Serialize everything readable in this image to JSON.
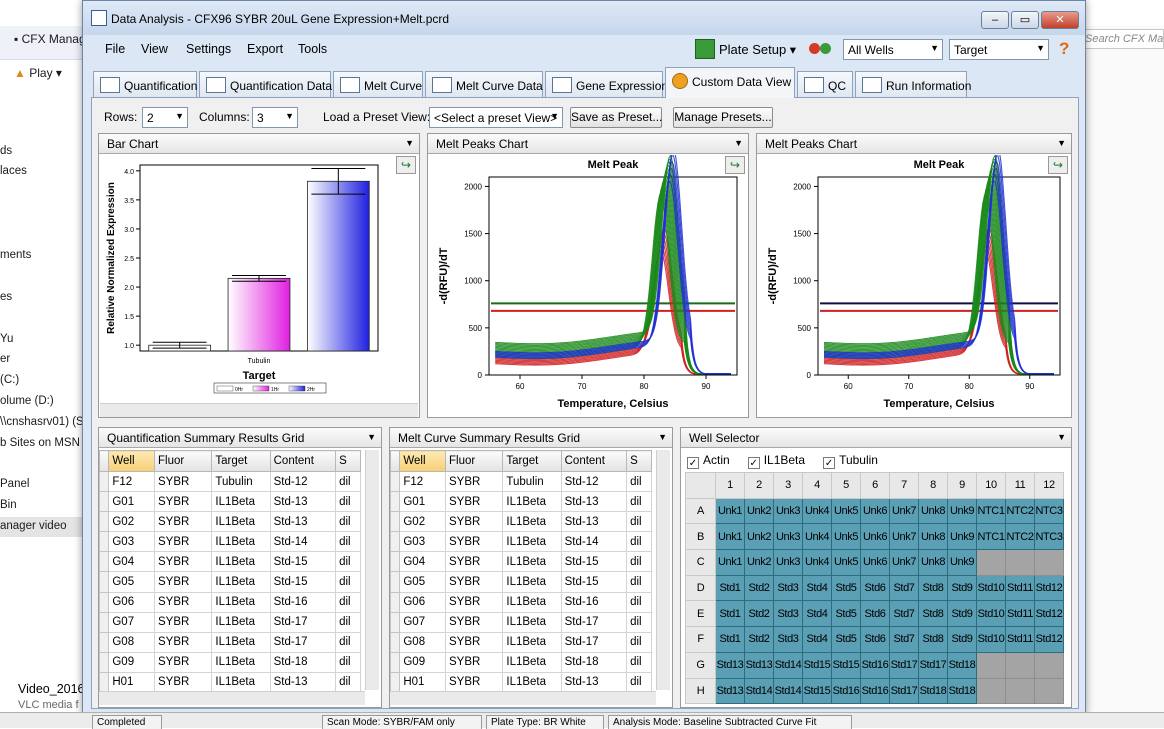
{
  "background": {
    "app_label": "CFX Manage",
    "play_label": "Play",
    "search_placeholder": "Search CFX Ma",
    "list_items": [
      "ds",
      "laces",
      "ments",
      "es",
      "Yu",
      "er",
      " (C:)",
      "olume (D:)",
      "\\\\cnshasrv01) (S",
      "b Sites on MSN",
      "Panel",
      "Bin",
      "anager video"
    ],
    "video_title": "Video_2016",
    "video_sub": "VLC media f"
  },
  "window": {
    "title": "Data Analysis - CFX96 SYBR 20uL Gene Expression+Melt.pcrd"
  },
  "menu": [
    "File",
    "View",
    "Settings",
    "Export",
    "Tools"
  ],
  "toolbar": {
    "plate_setup": "Plate Setup",
    "wells_combo": "All Wells",
    "target_combo": "Target",
    "help": "?"
  },
  "tabs": [
    "Quantification",
    "Quantification Data",
    "Melt Curve",
    "Melt Curve Data",
    "Gene Expression",
    "Custom Data View",
    "QC",
    "Run Information"
  ],
  "view_controls": {
    "rows_label": "Rows:",
    "rows_value": "2",
    "columns_label": "Columns:",
    "columns_value": "3",
    "preset_label": "Load a Preset View:",
    "preset_placeholder": "<Select a preset View>",
    "save_preset": "Save as Preset...",
    "manage_presets": "Manage Presets..."
  },
  "panels": {
    "bar_chart": "Bar Chart",
    "melt_peaks_1": "Melt Peaks Chart",
    "melt_peaks_2": "Melt Peaks Chart",
    "quant_grid": "Quantification Summary Results Grid",
    "melt_grid": "Melt Curve Summary Results Grid",
    "well_selector": "Well Selector"
  },
  "chart_data": [
    {
      "type": "bar",
      "ylabel": "Relative Normalized Expression",
      "xlabel": "Target",
      "categories": [
        "Tubulin"
      ],
      "series": [
        {
          "name": "0Hr",
          "values": [
            1.0
          ],
          "error": [
            0.05
          ],
          "color": "#ffffff"
        },
        {
          "name": "1Hr",
          "values": [
            2.15
          ],
          "error": [
            0.05
          ],
          "color": "#e020e0"
        },
        {
          "name": "2Hr",
          "values": [
            3.82
          ],
          "error": [
            0.22
          ],
          "color": "#2020e0"
        }
      ],
      "ylim": [
        0.9,
        4.1
      ],
      "yticks": [
        "1.0",
        "1.5",
        "2.0",
        "2.5",
        "3.0",
        "3.5",
        "4.0"
      ],
      "legend": [
        "0Hr",
        "1Hr",
        "2Hr"
      ]
    },
    {
      "type": "line",
      "title": "Melt Peak",
      "xlabel": "Temperature, Celsius",
      "ylabel": "-d(RFU)/dT",
      "xlim": [
        55,
        95
      ],
      "ylim": [
        0,
        2100
      ],
      "xticks": [
        "60",
        "70",
        "80",
        "90"
      ],
      "yticks": [
        "0",
        "500",
        "1000",
        "1500",
        "2000"
      ],
      "thresholds": [
        {
          "y": 760,
          "color": "#1a6b1a"
        },
        {
          "y": 680,
          "color": "#d02020"
        }
      ],
      "series": [
        {
          "name": "IL1Beta",
          "color": "#1a8a1a",
          "peak_x": 83.5,
          "peak_y": 1850
        },
        {
          "name": "Actin",
          "color": "#d02020",
          "peak_x": 83.0,
          "peak_y": 1250
        },
        {
          "name": "Tubulin",
          "color": "#2030d0",
          "peak_x": 84.5,
          "peak_y": 2020
        }
      ]
    },
    {
      "type": "line",
      "title": "Melt Peak",
      "xlabel": "Temperature, Celsius",
      "ylabel": "-d(RFU)/dT",
      "xlim": [
        55,
        95
      ],
      "ylim": [
        0,
        2100
      ],
      "xticks": [
        "60",
        "70",
        "80",
        "90"
      ],
      "yticks": [
        "0",
        "500",
        "1000",
        "1500",
        "2000"
      ],
      "thresholds": [
        {
          "y": 760,
          "color": "#101040"
        },
        {
          "y": 680,
          "color": "#d02020"
        }
      ],
      "series": [
        {
          "name": "IL1Beta",
          "color": "#1a8a1a",
          "peak_x": 83.5,
          "peak_y": 1850
        },
        {
          "name": "Actin",
          "color": "#d02020",
          "peak_x": 83.0,
          "peak_y": 1250
        },
        {
          "name": "Tubulin",
          "color": "#2030d0",
          "peak_x": 84.5,
          "peak_y": 2020
        }
      ]
    }
  ],
  "quant_table": {
    "columns": [
      "Well",
      "Fluor",
      "Target",
      "Content",
      "S"
    ],
    "rows": [
      [
        "F12",
        "SYBR",
        "Tubulin",
        "Std-12",
        "dil"
      ],
      [
        "G01",
        "SYBR",
        "IL1Beta",
        "Std-13",
        "dil"
      ],
      [
        "G02",
        "SYBR",
        "IL1Beta",
        "Std-13",
        "dil"
      ],
      [
        "G03",
        "SYBR",
        "IL1Beta",
        "Std-14",
        "dil"
      ],
      [
        "G04",
        "SYBR",
        "IL1Beta",
        "Std-15",
        "dil"
      ],
      [
        "G05",
        "SYBR",
        "IL1Beta",
        "Std-15",
        "dil"
      ],
      [
        "G06",
        "SYBR",
        "IL1Beta",
        "Std-16",
        "dil"
      ],
      [
        "G07",
        "SYBR",
        "IL1Beta",
        "Std-17",
        "dil"
      ],
      [
        "G08",
        "SYBR",
        "IL1Beta",
        "Std-17",
        "dil"
      ],
      [
        "G09",
        "SYBR",
        "IL1Beta",
        "Std-18",
        "dil"
      ],
      [
        "H01",
        "SYBR",
        "IL1Beta",
        "Std-13",
        "dil"
      ]
    ]
  },
  "melt_table": {
    "columns": [
      "Well",
      "Fluor",
      "Target",
      "Content",
      "S"
    ],
    "rows": [
      [
        "F12",
        "SYBR",
        "Tubulin",
        "Std-12",
        "dil"
      ],
      [
        "G01",
        "SYBR",
        "IL1Beta",
        "Std-13",
        "dil"
      ],
      [
        "G02",
        "SYBR",
        "IL1Beta",
        "Std-13",
        "dil"
      ],
      [
        "G03",
        "SYBR",
        "IL1Beta",
        "Std-14",
        "dil"
      ],
      [
        "G04",
        "SYBR",
        "IL1Beta",
        "Std-15",
        "dil"
      ],
      [
        "G05",
        "SYBR",
        "IL1Beta",
        "Std-15",
        "dil"
      ],
      [
        "G06",
        "SYBR",
        "IL1Beta",
        "Std-16",
        "dil"
      ],
      [
        "G07",
        "SYBR",
        "IL1Beta",
        "Std-17",
        "dil"
      ],
      [
        "G08",
        "SYBR",
        "IL1Beta",
        "Std-17",
        "dil"
      ],
      [
        "G09",
        "SYBR",
        "IL1Beta",
        "Std-18",
        "dil"
      ],
      [
        "H01",
        "SYBR",
        "IL1Beta",
        "Std-13",
        "dil"
      ]
    ]
  },
  "well_selector": {
    "targets": [
      {
        "name": "Actin",
        "checked": true
      },
      {
        "name": "IL1Beta",
        "checked": true
      },
      {
        "name": "Tubulin",
        "checked": true
      }
    ],
    "columns": [
      "1",
      "2",
      "3",
      "4",
      "5",
      "6",
      "7",
      "8",
      "9",
      "10",
      "11",
      "12"
    ],
    "rows": [
      {
        "label": "A",
        "cells": [
          "Unk1",
          "Unk2",
          "Unk3",
          "Unk4",
          "Unk5",
          "Unk6",
          "Unk7",
          "Unk8",
          "Unk9",
          "NTC1",
          "NTC2",
          "NTC3"
        ]
      },
      {
        "label": "B",
        "cells": [
          "Unk1",
          "Unk2",
          "Unk3",
          "Unk4",
          "Unk5",
          "Unk6",
          "Unk7",
          "Unk8",
          "Unk9",
          "NTC1",
          "NTC2",
          "NTC3"
        ]
      },
      {
        "label": "C",
        "cells": [
          "Unk1",
          "Unk2",
          "Unk3",
          "Unk4",
          "Unk5",
          "Unk6",
          "Unk7",
          "Unk8",
          "Unk9",
          "",
          "",
          ""
        ]
      },
      {
        "label": "D",
        "cells": [
          "Std1",
          "Std2",
          "Std3",
          "Std4",
          "Std5",
          "Std6",
          "Std7",
          "Std8",
          "Std9",
          "Std10",
          "Std11",
          "Std12"
        ]
      },
      {
        "label": "E",
        "cells": [
          "Std1",
          "Std2",
          "Std3",
          "Std4",
          "Std5",
          "Std6",
          "Std7",
          "Std8",
          "Std9",
          "Std10",
          "Std11",
          "Std12"
        ]
      },
      {
        "label": "F",
        "cells": [
          "Std1",
          "Std2",
          "Std3",
          "Std4",
          "Std5",
          "Std6",
          "Std7",
          "Std8",
          "Std9",
          "Std10",
          "Std11",
          "Std12"
        ]
      },
      {
        "label": "G",
        "cells": [
          "Std13",
          "Std13",
          "Std14",
          "Std15",
          "Std15",
          "Std16",
          "Std17",
          "Std17",
          "Std18",
          "",
          "",
          ""
        ]
      },
      {
        "label": "H",
        "cells": [
          "Std13",
          "Std14",
          "Std14",
          "Std15",
          "Std16",
          "Std16",
          "Std17",
          "Std18",
          "Std18",
          "",
          "",
          ""
        ]
      }
    ]
  },
  "status_bar": [
    "Completed",
    "Scan Mode: SYBR/FAM only",
    "Plate Type: BR White",
    "Analysis Mode: Baseline Subtracted Curve Fit"
  ]
}
